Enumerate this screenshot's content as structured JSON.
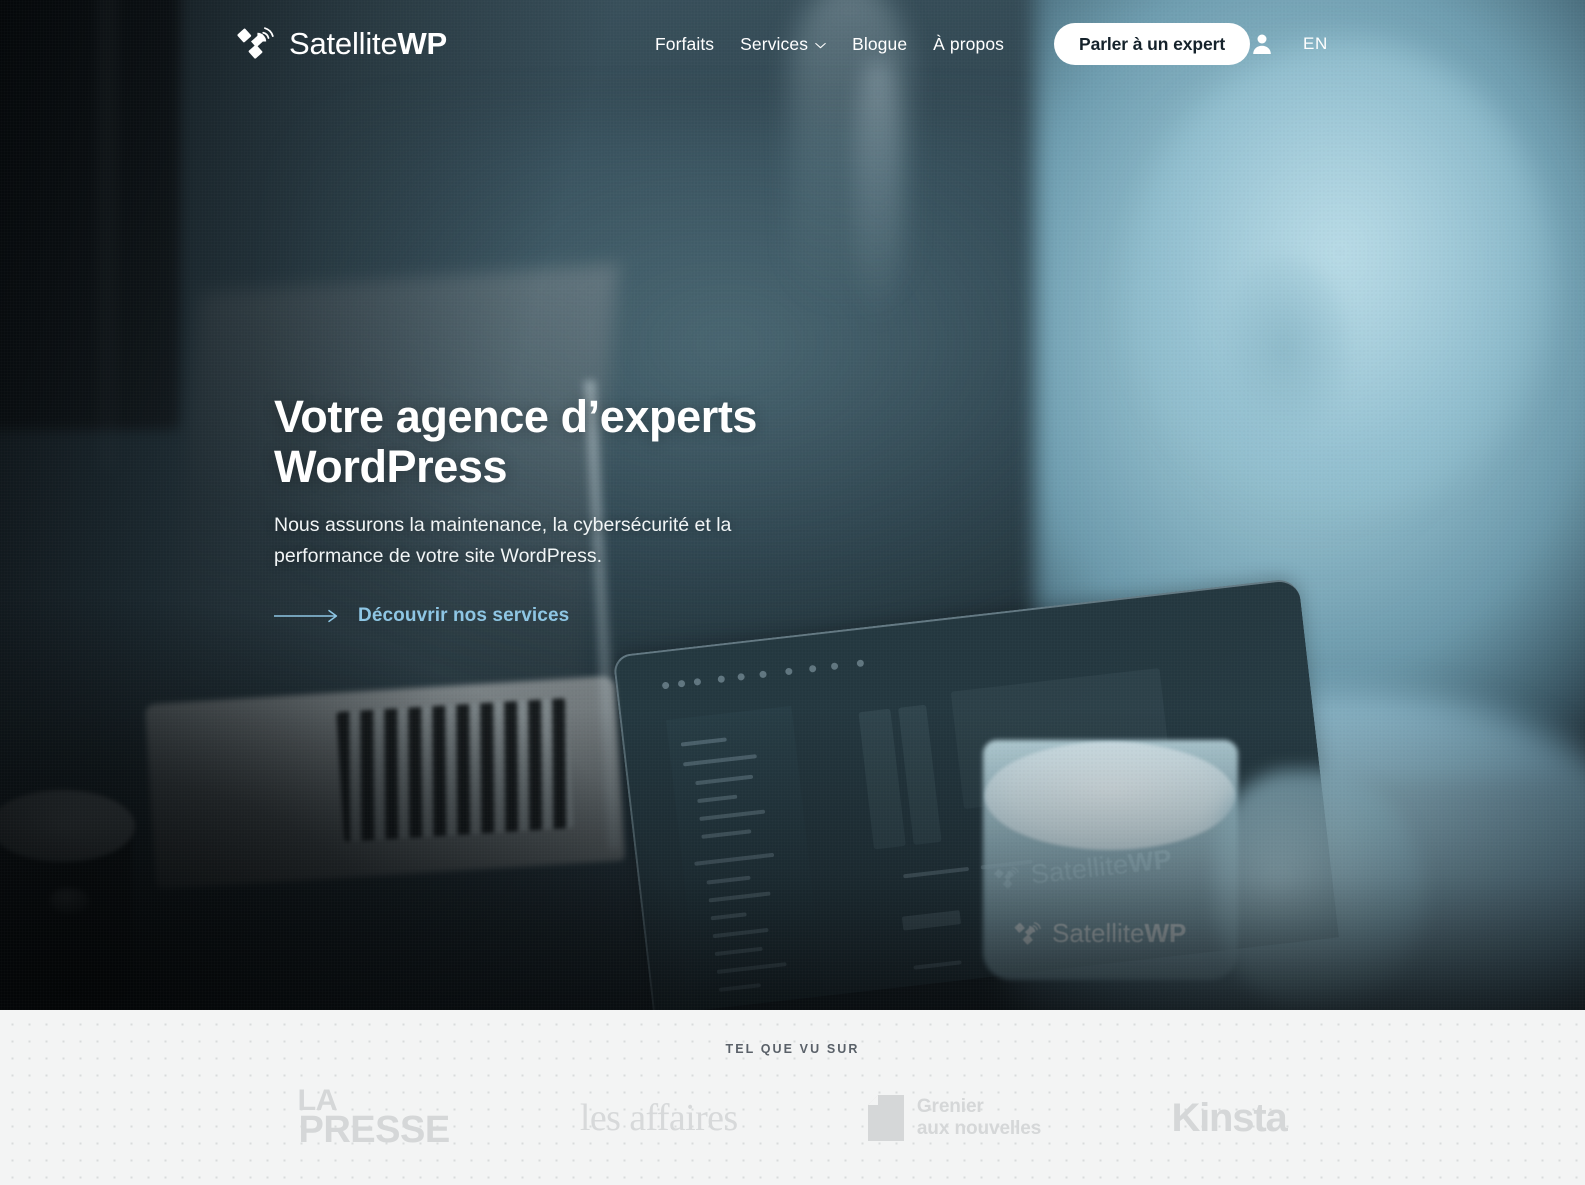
{
  "brand": {
    "name_light": "Satellite",
    "name_bold": "WP",
    "icon": "satellite-icon"
  },
  "header": {
    "nav": [
      {
        "label": "Forfaits",
        "icon": null
      },
      {
        "label": "Services",
        "icon": "chevron-down-icon"
      },
      {
        "label": "Blogue",
        "icon": null
      },
      {
        "label": "À propos",
        "icon": null
      }
    ],
    "cta_label": "Parler à un expert",
    "account_icon": "user-icon",
    "language": "EN"
  },
  "hero": {
    "title_line1": "Votre agence d’experts",
    "title_line2": "WordPress",
    "subtitle": "Nous assurons la maintenance, la cybersécurité et la performance de votre site WordPress.",
    "cta_label": "Découvrir nos services",
    "cta_icon": "long-arrow-right-icon",
    "cta_color": "#8ec6e4",
    "screen_watermark_light": "Satellite",
    "screen_watermark_bold": "WP",
    "mug_watermark_light": "Satellite",
    "mug_watermark_bold": "WP"
  },
  "press": {
    "eyebrow": "TEL QUE VU SUR",
    "logos": [
      {
        "name": "la-presse",
        "line1": "LA",
        "line2": "PRESSE"
      },
      {
        "name": "les-affaires",
        "text": "les affaires"
      },
      {
        "name": "grenier-aux-nouvelles",
        "line1": "Grenier",
        "line2": "aux nouvelles",
        "icon": "document-icon"
      },
      {
        "name": "kinsta",
        "text": "Kinsta"
      }
    ]
  },
  "colors": {
    "hero_dark": "#15202a",
    "hero_teal": "#3d5560",
    "person_cyan": "#a9d1dd",
    "accent_link": "#8ec6e4",
    "press_bg": "#f3f4f4",
    "press_logo_gray": "#d5d7d8",
    "press_eyebrow_gray": "#5a6169",
    "cta_bg": "#ffffff",
    "cta_text": "#15222b"
  }
}
